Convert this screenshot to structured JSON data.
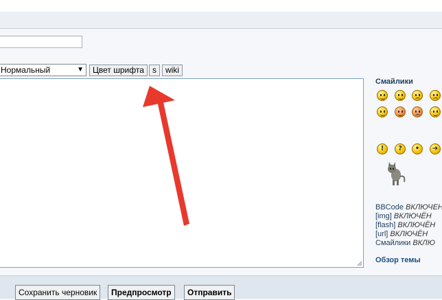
{
  "editor": {
    "font_size_select": {
      "selected": "Нормальный"
    },
    "buttons": {
      "font_color": "Цвет шрифта",
      "s": "s",
      "wiki": "wiki"
    }
  },
  "sidebar": {
    "smilies_title": "Смайлики",
    "status": {
      "bbcode_label": "BBCode",
      "bbcode_value": "ВКЛЮЧЕН",
      "img_label": "[img]",
      "img_value": "ВКЛЮЧЁН",
      "flash_label": "[flash]",
      "flash_value": "ВКЛЮЧЁН",
      "url_label": "[url]",
      "url_value": "ВКЛЮЧЁН",
      "smilies_label": "Смайлики",
      "smilies_value": "ВКЛЮ"
    },
    "topic_review": "Обзор темы"
  },
  "footer": {
    "save_draft": "Сохранить черновик",
    "preview": "Предпросмотр",
    "submit": "Отправить"
  },
  "colors": {
    "accent_arrow": "#e8392d",
    "link": "#1c4f80"
  }
}
